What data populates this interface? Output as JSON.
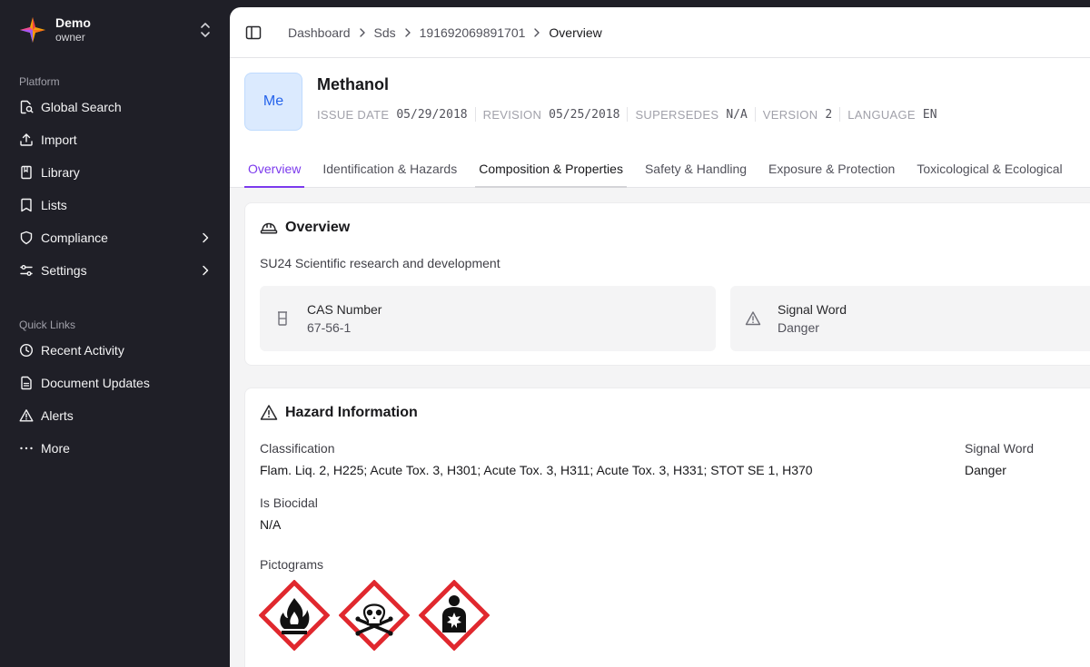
{
  "org": {
    "name": "Demo",
    "role": "owner"
  },
  "sidebar": {
    "platform_heading": "Platform",
    "platform_items": [
      {
        "label": "Global Search",
        "icon": "search-document-icon",
        "has_chevron": false
      },
      {
        "label": "Import",
        "icon": "upload-icon",
        "has_chevron": false
      },
      {
        "label": "Library",
        "icon": "book-icon",
        "has_chevron": false
      },
      {
        "label": "Lists",
        "icon": "bookmark-icon",
        "has_chevron": false
      },
      {
        "label": "Compliance",
        "icon": "shield-icon",
        "has_chevron": true
      },
      {
        "label": "Settings",
        "icon": "sliders-icon",
        "has_chevron": true
      }
    ],
    "quick_heading": "Quick Links",
    "quick_items": [
      {
        "label": "Recent Activity",
        "icon": "clock-icon"
      },
      {
        "label": "Document Updates",
        "icon": "file-text-icon"
      },
      {
        "label": "Alerts",
        "icon": "warning-icon"
      },
      {
        "label": "More",
        "icon": "ellipsis-icon"
      }
    ]
  },
  "breadcrumb": [
    "Dashboard",
    "Sds",
    "191692069891701",
    "Overview"
  ],
  "document": {
    "avatar": "Me",
    "title": "Methanol",
    "meta": [
      {
        "label": "ISSUE DATE",
        "value": "05/29/2018"
      },
      {
        "label": "REVISION",
        "value": "05/25/2018"
      },
      {
        "label": "SUPERSEDES",
        "value": "N/A"
      },
      {
        "label": "VERSION",
        "value": "2"
      },
      {
        "label": "LANGUAGE",
        "value": "EN"
      }
    ]
  },
  "tabs": [
    "Overview",
    "Identification & Hazards",
    "Composition & Properties",
    "Safety & Handling",
    "Exposure & Protection",
    "Toxicological & Ecological"
  ],
  "active_tab": "Overview",
  "overview": {
    "title": "Overview",
    "use": "SU24 Scientific research and development",
    "cas_label": "CAS Number",
    "cas_value": "67-56-1",
    "signal_label": "Signal Word",
    "signal_value": "Danger"
  },
  "hazard": {
    "title": "Hazard Information",
    "classification_label": "Classification",
    "classification_value": "Flam. Liq. 2, H225; Acute Tox. 3, H301; Acute Tox. 3, H311; Acute Tox. 3, H331; STOT SE 1, H370",
    "signal_label": "Signal Word",
    "signal_value": "Danger",
    "biocidal_label": "Is Biocidal",
    "biocidal_value": "N/A",
    "pictograms_label": "Pictograms",
    "pictograms": [
      "flame-pictogram-icon",
      "skull-crossbones-pictogram-icon",
      "health-hazard-pictogram-icon"
    ]
  },
  "colors": {
    "accent": "#7c3aed",
    "sidebar_bg": "#1f1f27",
    "pictogram_border": "#e0282e",
    "avatar_bg": "#dbeafe",
    "avatar_text": "#2563eb"
  }
}
